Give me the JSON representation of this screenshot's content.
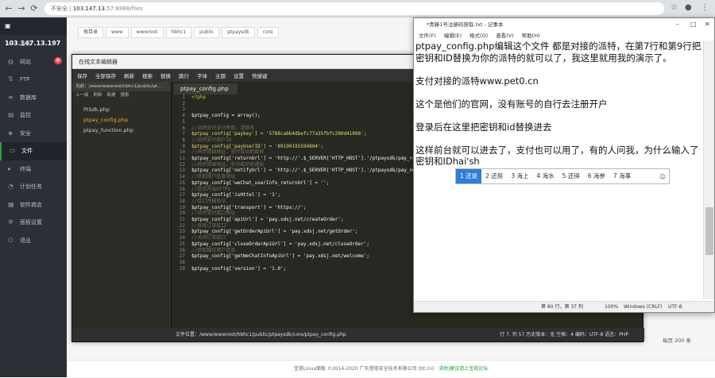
{
  "browser": {
    "warning": "不安全",
    "url_host": "103.147.13.",
    "url_rest": "57:8888/files"
  },
  "sidebar": {
    "server": "103.147.13.197",
    "badge": "0",
    "items": [
      {
        "label": "首页",
        "icon": "home-icon"
      },
      {
        "label": "网站",
        "icon": "globe-icon"
      },
      {
        "label": "FTP",
        "icon": "ftp-icon"
      },
      {
        "label": "数据库",
        "icon": "database-icon"
      },
      {
        "label": "监控",
        "icon": "monitor-icon"
      },
      {
        "label": "安全",
        "icon": "shield-icon"
      },
      {
        "label": "文件",
        "icon": "folder-icon"
      },
      {
        "label": "终端",
        "icon": "terminal-icon"
      },
      {
        "label": "计划任务",
        "icon": "clock-icon"
      },
      {
        "label": "软件商店",
        "icon": "store-icon"
      },
      {
        "label": "面板设置",
        "icon": "gear-icon"
      },
      {
        "label": "退出",
        "icon": "logout-icon"
      }
    ]
  },
  "breadcrumb": [
    "根目录",
    "www",
    "wwwroot",
    "hbhc1",
    "public",
    "ptpaysdk",
    "core"
  ],
  "editor": {
    "title": "在线文本编辑器",
    "toolbar": [
      "保存",
      "全部保存",
      "刷新",
      "搜索",
      "替换",
      "跳行",
      "字体",
      "主题",
      "设置",
      "快捷键"
    ],
    "path": "当前：/www/wwwroot/hbhc1/public/pt...",
    "ops": [
      "上一级",
      "刷新",
      "新建",
      "搜索"
    ],
    "files": [
      "PtSdk.php",
      "ptpay_config.php",
      "ptpay_function.php"
    ],
    "active_tab": "ptpay_config.php",
    "status_path": "文件位置：/www/wwwroot/hbhc1/public/ptpaysdk/core/ptpay_config.php",
    "status_right": "行 7, 列 57    历史版本：无    空格：4    编码：UTF-8    语言：PHP",
    "code_lines": [
      {
        "n": "1",
        "t": "<?php",
        "c": "vr"
      },
      {
        "n": "2",
        "t": "",
        "c": ""
      },
      {
        "n": "3",
        "t": "",
        "c": ""
      },
      {
        "n": "4",
        "t": "$ptpay_config = array();",
        "c": ""
      },
      {
        "n": "5",
        "t": "",
        "c": ""
      },
      {
        "n": "6",
        "t": "//派特支付支付密钥，请修改",
        "c": "cm"
      },
      {
        "n": "7",
        "t": "$ptpay_config['paykey'] = '5788cabb4dbefc77a35fbfc200d41008';",
        "c": "st"
      },
      {
        "n": "8",
        "t": "//派特支付商户ID",
        "c": "cm"
      },
      {
        "n": "9",
        "t": "$ptpay_config['payUserID'] = '89190195594804';",
        "c": "st"
      },
      {
        "n": "10",
        "t": "//同步回调地址，支付成功后跳转",
        "c": "cm"
      },
      {
        "n": "11",
        "t": "$ptpay_config['returnUrl'] = 'http://'.$_SERVER['HTTP_HOST'].'/ptpaysdk/pay_return.php';",
        "c": ""
      },
      {
        "n": "12",
        "t": "//异步回调地址，支付成功后通知",
        "c": "cm"
      },
      {
        "n": "13",
        "t": "$ptpay_config['notifyUrl'] = 'http://'.$_SERVER['HTTP_HOST'].'/ptpaysdk/pay_notify.php';",
        "c": ""
      },
      {
        "n": "14",
        "t": "//获取用户信息地址",
        "c": "cm"
      },
      {
        "n": "15",
        "t": "$ptpay_config['weChat_userInfo_returnUrl'] = '';",
        "c": ""
      },
      {
        "n": "16",
        "t": "//是否开启HTTPS",
        "c": "cm"
      },
      {
        "n": "17",
        "t": "$ptpay_config['isHttel'] = '1';",
        "c": ""
      },
      {
        "n": "18",
        "t": "//接口传输协议",
        "c": "cm"
      },
      {
        "n": "19",
        "t": "$ptpay_config['transport'] = 'https://';",
        "c": ""
      },
      {
        "n": "20",
        "t": "//派特支付接口地址",
        "c": "cm"
      },
      {
        "n": "21",
        "t": "$ptpay_config['apiUrl'] = 'pay.xdsj.net/createOrder';",
        "c": ""
      },
      {
        "n": "22",
        "t": "//查询订单接口",
        "c": "cm"
      },
      {
        "n": "23",
        "t": "$ptpay_config['getOrderApiUrl'] = 'pay.xdsj.net/getOrder';",
        "c": ""
      },
      {
        "n": "24",
        "t": "//关闭订单接口",
        "c": "cm"
      },
      {
        "n": "25",
        "t": "$ptpay_config['closeOrderApiUrl'] = 'pay.xdsj.net/closeOrder';",
        "c": ""
      },
      {
        "n": "26",
        "t": "//获取微信用户信息",
        "c": "cm"
      },
      {
        "n": "27",
        "t": "$ptpay_config['getWeChatInfoApiUrl'] = 'pay.xdsj.net/welcome';",
        "c": ""
      },
      {
        "n": "28",
        "t": "",
        "c": ""
      },
      {
        "n": "29",
        "t": "$ptpay_config['version'] = '1.0';",
        "c": ""
      }
    ]
  },
  "notepad": {
    "title": "*青藤1号注册码获取.txt - 记事本",
    "menu": [
      "文件(F)",
      "编辑(E)",
      "格式(O)",
      "查看(V)",
      "帮助(H)"
    ],
    "paragraphs": [
      "ptpay_config.php编辑这个文件 都是对接的派特，在第7行和第9行把密钥和ID替换为你的派特的就可以了，我这里就用我的演示了。",
      "支付对接的派特www.pet0.cn",
      "这个是他们的官网，没有账号的自行去注册开户",
      "登录后在这里把密钥和id替换进去",
      "这样前台就可以进去了，支付也可以用了，有的人问我，为什么输入了密钥和IDhai'sh"
    ],
    "status": {
      "pos": "第 80 行，第 37 列",
      "zoom": "100%",
      "eol": "Windows (CRLF)",
      "enc": "UTF-8"
    }
  },
  "ime": {
    "candidates": [
      "1 还是",
      "2 还挺",
      "3 海上",
      "4 海水",
      "5 还得",
      "6 海参",
      "7 海事"
    ],
    "emoji": "☺"
  },
  "page": {
    "size": "每页 200 条",
    "footer": "宝塔Linux面板 ©2014-2020 广东堡塔安全技术有限公司 (bt.cn)",
    "footer_link": "求助|建议请上宝塔论坛"
  }
}
